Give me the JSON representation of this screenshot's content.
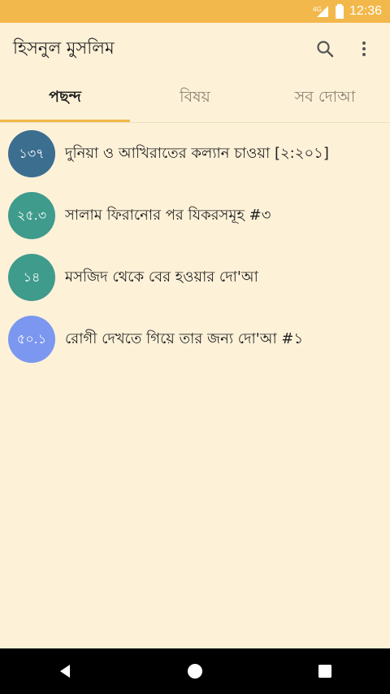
{
  "status_bar": {
    "network_label": "4G",
    "time": "12:36"
  },
  "app_bar": {
    "title": "হিসনুল মুসলিম",
    "search_icon": "search-icon",
    "more_icon": "more-vert-icon"
  },
  "tabs": [
    {
      "label": "পছন্দ",
      "active": true
    },
    {
      "label": "বিষয়",
      "active": false
    },
    {
      "label": "সব দোআ",
      "active": false
    }
  ],
  "favorites": [
    {
      "badge": "১৩৭",
      "title": "দুনিয়া ও আখিরাতের কল্যান চাওয়া [২:২০১]",
      "color": "#3c6e8f"
    },
    {
      "badge": "২৫.৩",
      "title": "সালাম ফিরানোর পর যিকরসমূহ #৩",
      "color": "#3f9b8c"
    },
    {
      "badge": "১৪",
      "title": "মসজিদ থেকে বের হওয়ার দো'আ",
      "color": "#3f9b8c"
    },
    {
      "badge": "৫০.১",
      "title": "রোগী দেখতে গিয়ে তার জন্য দো'আ #১",
      "color": "#7b97f0"
    }
  ],
  "colors": {
    "status_bar": "#f2b84b",
    "background": "#fdf1d8",
    "tab_indicator": "#f2b84b"
  },
  "nav_bar": {
    "back_icon": "back-triangle-icon",
    "home_icon": "home-circle-icon",
    "recents_icon": "recents-square-icon"
  }
}
